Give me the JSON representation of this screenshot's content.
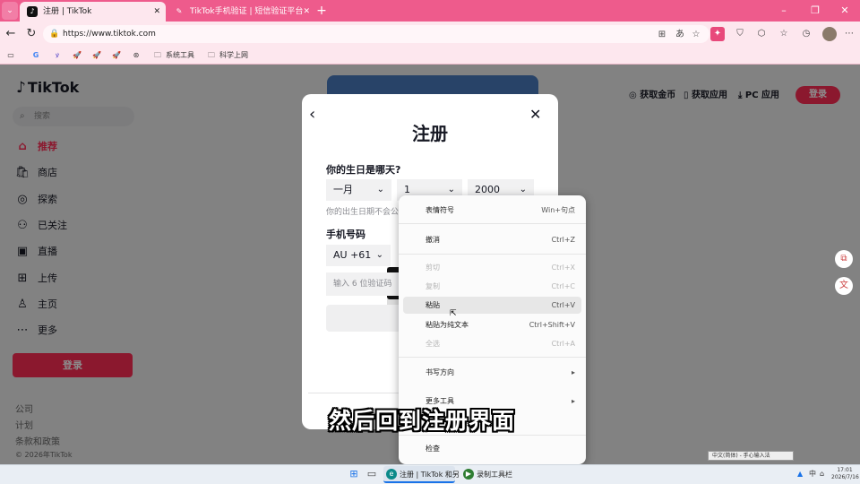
{
  "browser": {
    "tabs": [
      {
        "label": "注册 | TikTok",
        "close": "✕"
      },
      {
        "label": "TikTok手机验证 | 短信验证平台",
        "close": "✕"
      }
    ],
    "url": "https://www.tiktok.com",
    "bookmarks": [
      "G",
      "系统工具",
      "科学上网"
    ]
  },
  "page": {
    "logo": "TikTok",
    "search_placeholder": "搜索",
    "nav": [
      {
        "label": "推荐",
        "icon": "⌂"
      },
      {
        "label": "商店",
        "icon": "🛍"
      },
      {
        "label": "探索",
        "icon": "◎"
      },
      {
        "label": "已关注",
        "icon": "⚇"
      },
      {
        "label": "直播",
        "icon": "▣"
      },
      {
        "label": "上传",
        "icon": "⊞"
      },
      {
        "label": "主页",
        "icon": "♙"
      },
      {
        "label": "更多",
        "icon": "⋯"
      }
    ],
    "login_side": "登录",
    "footer": [
      "公司",
      "计划",
      "条款和政策",
      "© 2026年TikTok"
    ],
    "top_links": [
      "获取金币",
      "获取应用",
      "PC 应用"
    ],
    "login_top": "登录"
  },
  "modal": {
    "title": "注册",
    "birthday_label": "你的生日是哪天?",
    "month": "一月",
    "day": "1",
    "year": "2000",
    "birthday_help": "你的出生日期不会公",
    "phone_label": "手机号码",
    "country_code": "AU +61",
    "code_placeholder": "输入 6 位验证码"
  },
  "context_menu": {
    "items": [
      {
        "label": "表情符号",
        "shortcut": "Win+句点",
        "disabled": false
      },
      {
        "label": "撤消",
        "shortcut": "Ctrl+Z",
        "disabled": false
      },
      {
        "label": "剪切",
        "shortcut": "Ctrl+X",
        "disabled": true
      },
      {
        "label": "复制",
        "shortcut": "Ctrl+C",
        "disabled": true
      },
      {
        "label": "粘贴",
        "shortcut": "Ctrl+V",
        "disabled": false,
        "highlighted": true
      },
      {
        "label": "粘贴为纯文本",
        "shortcut": "Ctrl+Shift+V",
        "disabled": false
      },
      {
        "label": "全选",
        "shortcut": "Ctrl+A",
        "disabled": true
      },
      {
        "label": "书写方向",
        "shortcut": "▸",
        "disabled": false
      },
      {
        "label": "更多工具",
        "shortcut": "▸",
        "disabled": false
      },
      {
        "label": "检查",
        "shortcut": "",
        "disabled": false
      }
    ]
  },
  "subtitle": "然后回到注册界面",
  "ime_tooltip": "中文(简体) - 手心输入法",
  "taskbar": {
    "apps": [
      "注册 | TikTok 和另",
      "录制工具栏"
    ],
    "tray_lang": "中",
    "time": "17:01",
    "date": "2026/7/16"
  },
  "colors": {
    "accent": "#fe2c55",
    "chrome": "#ee5b8c"
  }
}
